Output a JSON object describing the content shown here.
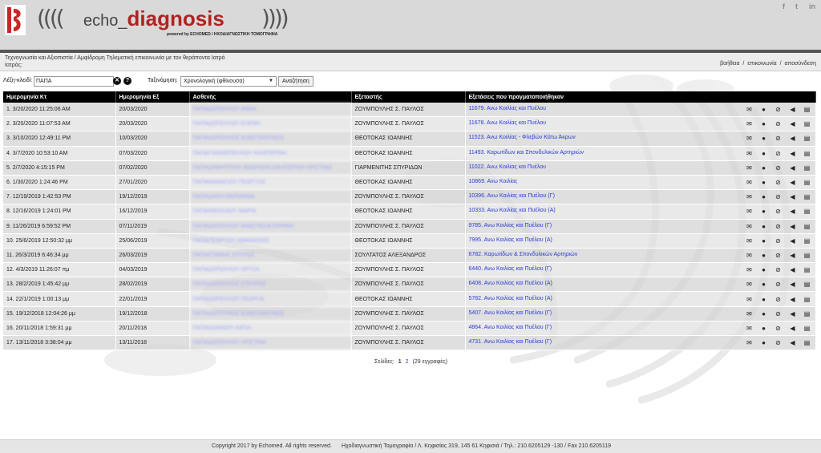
{
  "header": {
    "brand_echo": "echo_",
    "brand_diagnosis": "diagnosis",
    "powered_by": "powered by ECHOMED / ΗΧΟΔΙΑΓΝΩΣΤΙΚΗ ΤΟΜΟΓΡΑΦΙΑ",
    "social": [
      "f",
      "t",
      "in"
    ]
  },
  "infobar": {
    "line1": "Τεχνογνωσία και Αξιοπιστία / Αμφίδρομη Τηλεματική επικοινωνία με τον θεράποντα Ιατρό",
    "line2": "Ιατρός:",
    "links": [
      "βοήθεια",
      "επικοινωνία",
      "αποσύνδεση"
    ]
  },
  "search": {
    "keyword_label": "Λέξη-κλειδί:",
    "keyword_value": "ΠΑΠΑ",
    "sort_label": "Ταξινόμηση:",
    "sort_value": "Χρονολογική (φθίνουσα)",
    "button": "Αναζήτηση"
  },
  "table": {
    "columns": [
      "Ημερομηνία Κτ",
      "Ημερομηνία Εξ",
      "Ασθενής",
      "Εξεταστής",
      "Εξετάσεις που πραγματοποιήθηκαν"
    ],
    "rows": [
      {
        "date_kt": "1. 3/20/2020 11:25:06 AM",
        "date_ex": "20/03/2020",
        "patient": "ΠΑΠΑΔΟΠΟΥΛΟΥ ΑΝΝΑ",
        "examiner": "ΖΟΥΜΠΟΥΛΗΣ Σ. ΠΑΥΛΟΣ",
        "exam": "11679. Ανω Κοιλίας και Πυέλου"
      },
      {
        "date_kt": "2. 3/20/2020 11:07:53 AM",
        "date_ex": "20/03/2020",
        "patient": "ΠΑΠΑΔΟΠΟΥΛΟΥ ΕΛΕΝΗ",
        "examiner": "ΖΟΥΜΠΟΥΛΗΣ Σ. ΠΑΥΛΟΣ",
        "exam": "11678. Ανω Κοιλίας και Πυέλου"
      },
      {
        "date_kt": "3. 3/10/2020 12:49:11 PM",
        "date_ex": "10/03/2020",
        "patient": "ΠΑΠΑΔΟΠΟΥΛΟΣ ΚΩΝΣΤΑΝΤΙΝΟΣ",
        "examiner": "ΘΕΟΤΟΚΑΣ ΙΩΑΝΝΗΣ",
        "exam": "11523. Ανω Κοιλίας - Φλεβών Κάτω Άκρων"
      },
      {
        "date_kt": "4. 3/7/2020 10:53:10 AM",
        "date_ex": "07/03/2020",
        "patient": "ΠΑΠΑΓΙΑΝΝΟΠΟΥΛΟΥ ΑΙΚΑΤΕΡΙΝΗ",
        "examiner": "ΘΕΟΤΟΚΑΣ ΙΩΑΝΝΗΣ",
        "exam": "11493. Καρωτίδων και Σπονδυλικών Αρτηριών"
      },
      {
        "date_kt": "5. 2/7/2020 4:15:15 PM",
        "date_ex": "07/02/2020",
        "patient": "ΠΑΠΑΔΗΜΗΤΡΙΟΥ ΑΝΔΡΙΑΝΑ ΑΙΚΑΤΕΡΙΝΗ ΧΡΙΣΤΙΝΑ",
        "examiner": "ΓΙΑΡΜΕΝΙΤΗΣ ΣΠΥΡΙΔΩΝ",
        "exam": "11022. Ανω Κοιλίας και Πυέλου"
      },
      {
        "date_kt": "6. 1/30/2020 1:24:46 PM",
        "date_ex": "27/01/2020",
        "patient": "ΠΑΠΑΘΑΝΑΣΙΟΥ ΓΕΩΡΓΙΟΣ",
        "examiner": "ΘΕΟΤΟΚΑΣ ΙΩΑΝΝΗΣ",
        "exam": "10869. Ανω Κοιλίας"
      },
      {
        "date_kt": "7. 12/19/2019 1:42:53 PM",
        "date_ex": "19/12/2019",
        "patient": "ΠΑΠΑΔΑΚΗ ΜΑΡΙΑΝΝΑ",
        "examiner": "ΖΟΥΜΠΟΥΛΗΣ Σ. ΠΑΥΛΟΣ",
        "exam": "10396. Ανω Κοιλίας και Πυέλου (Γ)"
      },
      {
        "date_kt": "8. 12/16/2019 1:24:01 PM",
        "date_ex": "16/12/2019",
        "patient": "ΠΑΠΑΝΙΚΟΛΑΟΥ ΜΑΡΙΑ",
        "examiner": "ΘΕΟΤΟΚΑΣ ΙΩΑΝΝΗΣ",
        "exam": "10333. Ανω Κοιλίας και Πυέλου (Α)"
      },
      {
        "date_kt": "9. 11/26/2019 6:59:52 PM",
        "date_ex": "07/11/2019",
        "patient": "ΠΑΠΑΔΟΠΟΥΛΟΥ ΑΝΑΣΤΑΣΙΑ ΕΙΡΗΝΗ",
        "examiner": "ΖΟΥΜΠΟΥΛΗΣ Σ. ΠΑΥΛΟΣ",
        "exam": "9785. Ανω Κοιλίας και Πυέλου (Γ)"
      },
      {
        "date_kt": "10. 25/6/2019 12:50:32 μμ",
        "date_ex": "25/06/2019",
        "patient": "ΠΑΠΑΓΕΩΡΓΙΟΥ ΑΘΑΝΑΣΙΟΣ",
        "examiner": "ΘΕΟΤΟΚΑΣ ΙΩΑΝΝΗΣ",
        "exam": "7995. Ανω Κοιλίας και Πυέλου (Α)"
      },
      {
        "date_kt": "11. 26/3/2019 6:46:34 μμ",
        "date_ex": "26/03/2019",
        "patient": "ΠΑΠΑΣΤΑΘΗΣ ΣΠΥΡΟΣ",
        "examiner": "ΣΟΥΛΤΑΤΟΣ ΑΛΕΞΑΝΔΡΟΣ",
        "exam": "6782. Καρωτίδων & Σπονδυλικών Αρτηριών"
      },
      {
        "date_kt": "12. 4/3/2019 11:26:07 πμ",
        "date_ex": "04/03/2019",
        "patient": "ΠΑΠΑΔΟΠΟΥΛΟΥ ΧΡΥΣΑ",
        "examiner": "ΖΟΥΜΠΟΥΛΗΣ Σ. ΠΑΥΛΟΣ",
        "exam": "6440. Ανω Κοιλίας και Πυέλου (Γ)"
      },
      {
        "date_kt": "13. 28/2/2019 1:45:42 μμ",
        "date_ex": "28/02/2019",
        "patient": "ΠΑΠΑΔΟΠΟΥΛΟΣ ΣΤΑΥΡΟΣ",
        "examiner": "ΖΟΥΜΠΟΥΛΗΣ Σ. ΠΑΥΛΟΣ",
        "exam": "6408. Ανω Κοιλίας και Πυέλου (Α)"
      },
      {
        "date_kt": "14. 22/1/2019 1:00:13 μμ",
        "date_ex": "22/01/2019",
        "patient": "ΠΑΠΑΔΟΠΟΥΛΟΥ ΓΕΩΡΓΙΑ",
        "examiner": "ΘΕΟΤΟΚΑΣ ΙΩΑΝΝΗΣ",
        "exam": "5782. Ανω Κοιλίας και Πυέλου (Α)"
      },
      {
        "date_kt": "15. 19/12/2018 12:04:26 μμ",
        "date_ex": "19/12/2018",
        "patient": "ΠΑΠΑΔΟΠΟΥΛΟΣ ΚΩΝΣΤΑΝΤΙΝΟΣ",
        "examiner": "ΖΟΥΜΠΟΥΛΗΣ Σ. ΠΑΥΛΟΣ",
        "exam": "5407. Ανω Κοιλίας και Πυέλου (Γ)"
      },
      {
        "date_kt": "16. 20/11/2018 1:59:31 μμ",
        "date_ex": "20/11/2018",
        "patient": "ΠΑΠΑΙΩΑΝΝΟΥ ΚΑΤΙΑ",
        "examiner": "ΖΟΥΜΠΟΥΛΗΣ Σ. ΠΑΥΛΟΣ",
        "exam": "4864. Ανω Κοιλίας και Πυέλου (Γ)"
      },
      {
        "date_kt": "17. 13/11/2018 3:38:04 μμ",
        "date_ex": "13/11/2018",
        "patient": "ΠΑΠΑΔΟΠΟΥΛΟΥ ΧΡΙΣΤΙΝΑ",
        "examiner": "ΖΟΥΜΠΟΥΛΗΣ Σ. ΠΑΥΛΟΣ",
        "exam": "4731. Ανω Κοιλίας και Πυέλου (Γ)"
      }
    ]
  },
  "pagination": {
    "label": "Σελίδες:",
    "pages": [
      "1",
      "2"
    ],
    "current": "1",
    "total": "(29 εγγραφές)"
  },
  "footer": {
    "copyright": "Copyright 2017 by Echomed. All rights reserved.",
    "address": "Ηχοδιαγνωστική Τομογραφία / Λ. Κηφισίας 319, 145 61 Κηφισιά / Τηλ.: 210.6205129 -130 / Fax 210.6205119"
  },
  "colors": {
    "header_bg": "#d9d9d9",
    "brand_red": "#b22222",
    "table_header_bg": "#000000",
    "link_blue": "#2b3cd6"
  },
  "icons": [
    "envelope-icon",
    "person-icon",
    "paperclip-icon",
    "speaker-icon",
    "document-icon"
  ]
}
